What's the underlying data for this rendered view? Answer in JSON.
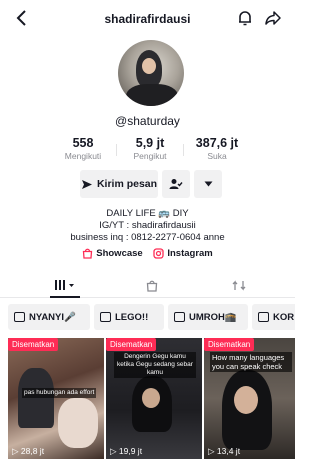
{
  "header": {
    "username": "shadirafirdausi",
    "back_icon": "arrow-left-icon",
    "bell_icon": "bell-icon",
    "share_icon": "share-icon"
  },
  "profile": {
    "handle": "@shaturday"
  },
  "stats": [
    {
      "value": "558",
      "label": "Mengikuti"
    },
    {
      "value": "5,9 jt",
      "label": "Pengikut"
    },
    {
      "value": "387,6 jt",
      "label": "Suka"
    }
  ],
  "actions": {
    "message_label": "Kirim pesan",
    "follow_icon": "user-check-icon",
    "more_icon": "caret-down-icon"
  },
  "bio": [
    "DAILY LIFE 🚌 DIY",
    "IG/YT : shadirafirdausii",
    "business inq : 0812-2277-0604 anne"
  ],
  "links": [
    {
      "label": "Showcase",
      "icon": "shop-icon"
    },
    {
      "label": "Instagram",
      "icon": "instagram-icon"
    }
  ],
  "tabs": [
    {
      "name": "videos",
      "icon": "grid-icon"
    },
    {
      "name": "private",
      "icon": "lock-bag-icon"
    },
    {
      "name": "reposts",
      "icon": "repost-icon"
    }
  ],
  "playlists": [
    {
      "label": "NYANYI🎤"
    },
    {
      "label": "LEGO!!"
    },
    {
      "label": "UMROH🕋"
    },
    {
      "label": "KOR"
    }
  ],
  "videos": [
    {
      "pinned_label": "Disematkan",
      "views": "28,8 jt",
      "caption": "pas hubungan ada effort"
    },
    {
      "pinned_label": "Disematkan",
      "views": "19,9 jt",
      "caption": "Dengerin Gegu kamu ketika Gegu sedang sebar kamu"
    },
    {
      "pinned_label": "Disematkan",
      "views": "13,4 jt",
      "caption": "How many languages you can speak check"
    }
  ],
  "colors": {
    "accent": "#fe2c55",
    "text": "#161823",
    "muted": "#8a8b91",
    "button_bg": "#f1f1f2"
  }
}
